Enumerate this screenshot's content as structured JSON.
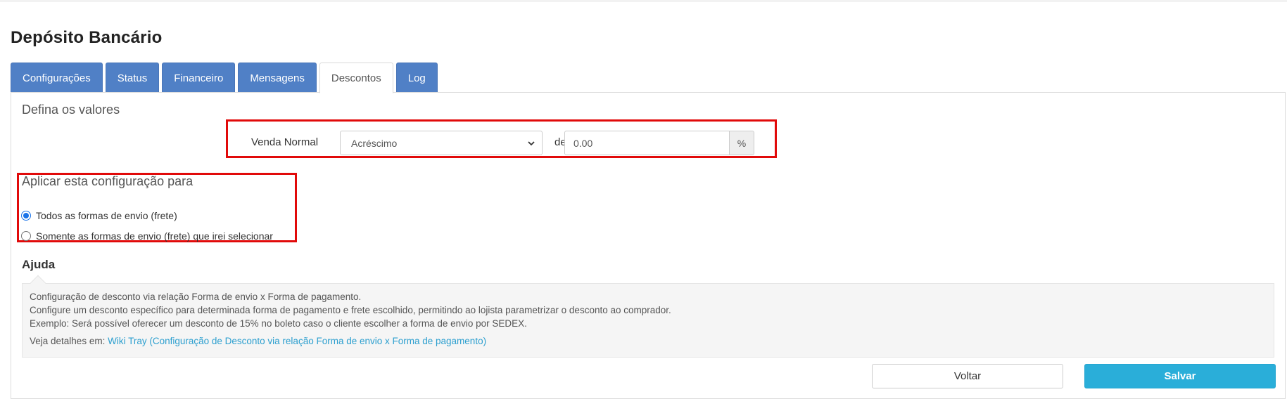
{
  "page": {
    "title": "Depósito Bancário"
  },
  "tabs": [
    {
      "label": "Configurações",
      "active": false
    },
    {
      "label": "Status",
      "active": false
    },
    {
      "label": "Financeiro",
      "active": false
    },
    {
      "label": "Mensagens",
      "active": false
    },
    {
      "label": "Descontos",
      "active": true
    },
    {
      "label": "Log",
      "active": false
    }
  ],
  "values_section": {
    "title": "Defina os valores",
    "venda_label": "Venda Normal",
    "type_select": {
      "selected": "Acréscimo"
    },
    "de_label": "de",
    "amount_input": {
      "value": "0.00"
    },
    "amount_addon": "%"
  },
  "apply_section": {
    "title": "Aplicar esta configuração para",
    "options": [
      {
        "label": "Todos as formas de envio (frete)",
        "checked": true
      },
      {
        "label": "Somente as formas de envio (frete) que irei selecionar",
        "checked": false
      }
    ]
  },
  "help": {
    "title": "Ajuda",
    "lines": [
      "Configuração de desconto via relação Forma de envio x Forma de pagamento.",
      "Configure um desconto específico para determinada forma de pagamento e frete escolhido, permitindo ao lojista parametrizar o desconto ao comprador.",
      "Exemplo: Será possível oferecer um desconto de 15% no boleto caso o cliente escolher a forma de envio por SEDEX."
    ],
    "details_prefix": "Veja detalhes em: ",
    "details_link": "Wiki Tray (Configuração de Desconto via relação Forma de envio x Forma de pagamento)"
  },
  "actions": {
    "back_label": "Voltar",
    "save_label": "Salvar"
  },
  "colors": {
    "tab_blue": "#5080c6",
    "highlight_red": "#e10a0a",
    "save_blue": "#2aaed9",
    "link_blue": "#2c9fcf"
  }
}
